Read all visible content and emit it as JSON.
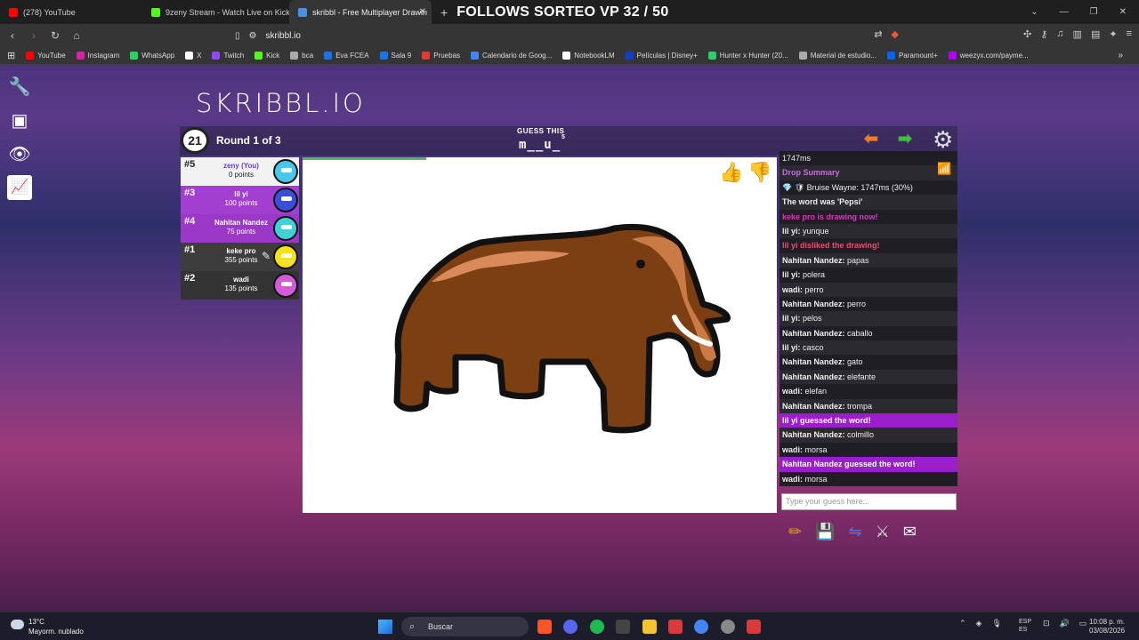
{
  "browser": {
    "tabs": [
      {
        "label": "(278) YouTube",
        "color": "#ff0000"
      },
      {
        "label": "9zeny Stream - Watch Live on Kick",
        "color": "#53fc18"
      },
      {
        "label": "skribbl - Free Multiplayer Drawin",
        "color": "#4a90e2",
        "active": true
      }
    ],
    "new_tab": "+",
    "banner": "FOLLOWS SORTEO VP 32 / 50",
    "url": "skribbl.io",
    "bookmarks": [
      {
        "label": "YouTube",
        "color": "#ff0000"
      },
      {
        "label": "Instagram",
        "color": "#d6249f"
      },
      {
        "label": "WhatsApp",
        "color": "#25d366"
      },
      {
        "label": "X",
        "color": "#ffffff"
      },
      {
        "label": "Twitch",
        "color": "#9146ff"
      },
      {
        "label": "Kick",
        "color": "#53fc18"
      },
      {
        "label": "bca",
        "color": "#aaaaaa"
      },
      {
        "label": "Eva FCEA",
        "color": "#1a73e8"
      },
      {
        "label": "Sala 9",
        "color": "#1a73e8"
      },
      {
        "label": "Pruebas",
        "color": "#e53935"
      },
      {
        "label": "Calendario de Goog...",
        "color": "#4285f4"
      },
      {
        "label": "NotebookLM",
        "color": "#ffffff"
      },
      {
        "label": "Películas | Disney+",
        "color": "#113ccf"
      },
      {
        "label": "Hunter x Hunter (20...",
        "color": "#2ecc71"
      },
      {
        "label": "Material de estudio...",
        "color": "#aaaaaa"
      },
      {
        "label": "Paramount+",
        "color": "#0064ff"
      },
      {
        "label": "weezyx.com/payme...",
        "color": "#b000ff"
      }
    ]
  },
  "game": {
    "logo": "SKRIBBL.IO",
    "timer": "21",
    "round": "Round 1 of 3",
    "guess_label": "GUESS THIS",
    "word_hint": "m__u_",
    "word_length": "5",
    "timer_fraction": 0.26
  },
  "players": [
    {
      "rank": "#5",
      "name": "zeny (You)",
      "points": "0 points",
      "avatar_color": "#46c9e8",
      "style": "light"
    },
    {
      "rank": "#3",
      "name": "lil yi",
      "points": "100 points",
      "avatar_color": "#3a4fd8",
      "style": "purple"
    },
    {
      "rank": "#4",
      "name": "Nahitan Nandez",
      "points": "75 points",
      "avatar_color": "#3fd1d6",
      "style": "purple"
    },
    {
      "rank": "#1",
      "name": "keke pro",
      "points": "355 points",
      "avatar_color": "#f3e21c",
      "style": "dark"
    },
    {
      "rank": "#2",
      "name": "wadi",
      "points": "135 points",
      "avatar_color": "#d35ad8",
      "style": "dark"
    }
  ],
  "chat": {
    "messages": [
      {
        "kind": "plain",
        "name": "",
        "text": "1747ms"
      },
      {
        "kind": "sys-purple",
        "name": "",
        "text": "Drop Summary"
      },
      {
        "kind": "plain",
        "name": "",
        "text": "💎 🛡 Bruise Wayne: 1747ms (30%)"
      },
      {
        "kind": "bold",
        "name": "",
        "text": "The word was 'Pepsi'"
      },
      {
        "kind": "sys-pink",
        "name": "",
        "text": "keke pro is drawing now!"
      },
      {
        "kind": "msg",
        "name": "lil yi:",
        "text": "yunque"
      },
      {
        "kind": "red",
        "name": "",
        "text": "lil yi disliked the drawing!"
      },
      {
        "kind": "msg",
        "name": "Nahitan Nandez:",
        "text": "papas"
      },
      {
        "kind": "msg",
        "name": "lil yi:",
        "text": "polera"
      },
      {
        "kind": "msg",
        "name": "wadi:",
        "text": "perro"
      },
      {
        "kind": "msg",
        "name": "Nahitan Nandez:",
        "text": "perro"
      },
      {
        "kind": "msg",
        "name": "lil yi:",
        "text": "pelos"
      },
      {
        "kind": "msg",
        "name": "Nahitan Nandez:",
        "text": "caballo"
      },
      {
        "kind": "msg",
        "name": "lil yi:",
        "text": "casco"
      },
      {
        "kind": "msg",
        "name": "Nahitan Nandez:",
        "text": "gato"
      },
      {
        "kind": "msg",
        "name": "Nahitan Nandez:",
        "text": "elefante"
      },
      {
        "kind": "msg",
        "name": "wadi:",
        "text": "elefan"
      },
      {
        "kind": "msg",
        "name": "Nahitan Nandez:",
        "text": "trompa"
      },
      {
        "kind": "guessed",
        "name": "",
        "text": "lil yi guessed the word!"
      },
      {
        "kind": "msg",
        "name": "Nahitan Nandez:",
        "text": "colmillo"
      },
      {
        "kind": "msg",
        "name": "wadi:",
        "text": "morsa"
      },
      {
        "kind": "guessed",
        "name": "",
        "text": "Nahitan Nandez guessed the word!"
      },
      {
        "kind": "msg",
        "name": "wadi:",
        "text": "morsa"
      }
    ],
    "input_placeholder": "Type your guess here..."
  },
  "taskbar": {
    "weather_temp": "13°C",
    "weather_desc": "Mayorm. nublado",
    "search": "Buscar",
    "lang1": "ESP",
    "lang2": "ES",
    "time": "10:08 p. m.",
    "date": "03/08/2026"
  }
}
